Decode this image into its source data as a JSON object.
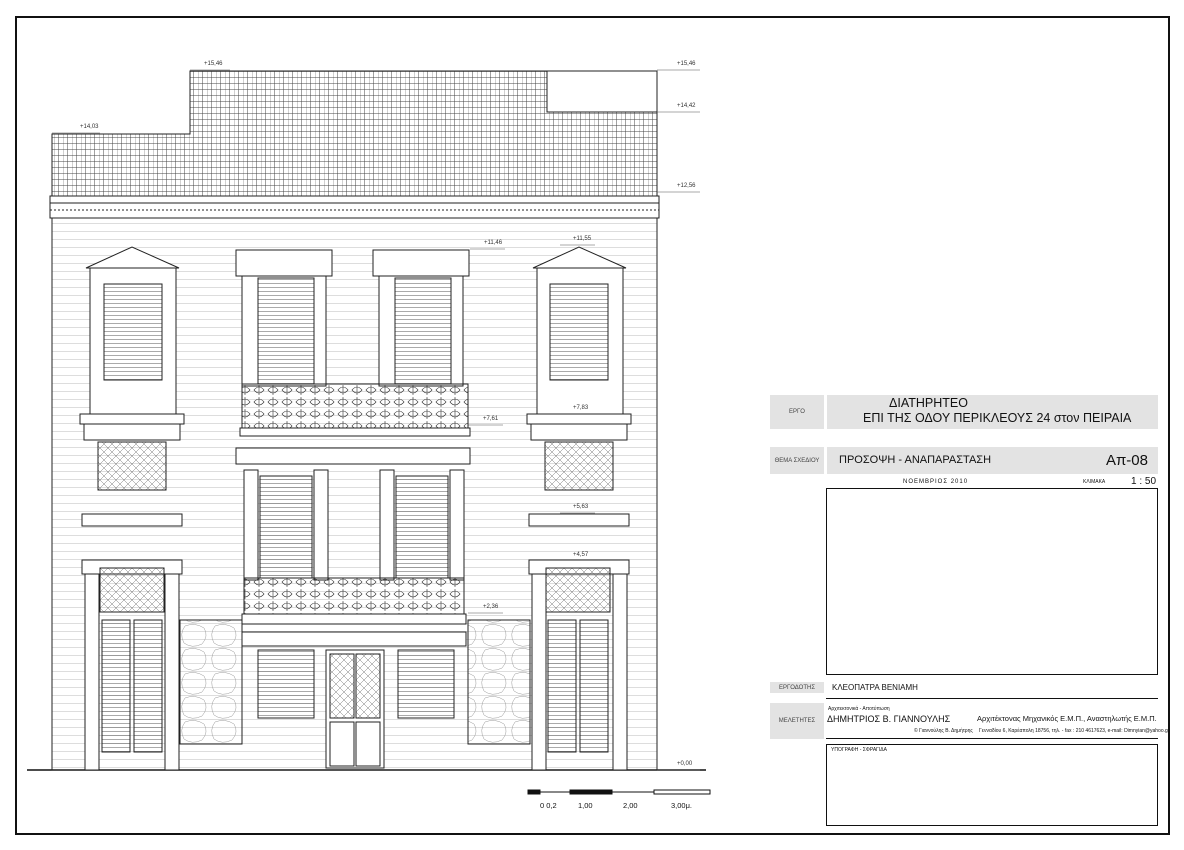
{
  "drawing": {
    "elevations": [
      "+15,46",
      "+15,46",
      "+14,42",
      "+14,03",
      "+12,56",
      "+11,46",
      "+11,55",
      "+7,61",
      "+7,83",
      "+5,63",
      "+4,57",
      "+2,36",
      "+0,00"
    ],
    "scale_bar": [
      "0 0,2",
      "1,00",
      "2,00",
      "3,00μ."
    ]
  },
  "titleblock": {
    "project_label": "ΕΡΓΟ",
    "project_line1": "ΔΙΑΤΗΡΗΤΕΟ",
    "project_line2": "ΕΠΙ ΤΗΣ ΟΔΟΥ ΠΕΡΙΚΛΕΟΥΣ 24 στον ΠΕΙΡΑΙΑ",
    "subject_label": "ΘΕΜΑ ΣΧΕΔΙΟΥ",
    "subject": "ΠΡΟΣΟΨΗ - ΑΝΑΠΑΡΑΣΤΑΣΗ",
    "code": "Απ-08",
    "date": "ΝΟΕΜΒΡΙΟΣ 2010",
    "scale_label": "ΚΛΙΜΑΚΑ",
    "scale": "1 : 50",
    "owner_label": "ΕΡΓΟΔΟΤΗΣ",
    "owner": "ΚΛΕΟΠΑΤΡΑ ΒΕΝΙΑΜΗ",
    "team_label": "ΜΕΛΕΤΗΤΕΣ",
    "team_desc": "Αρχιτεκτονικά - Αποτύπωση",
    "designer": "ΔΗΜΗΤΡΙΟΣ Β. ΓΙΑΝΝΟΥΛΗΣ",
    "designer_role": "Αρχιτέκτονας Μηχανικός Ε.Μ.Π., Αναστηλωτής Ε.Μ.Π.",
    "copyright": "© Γιαννούλης Β. Δημήτρης",
    "address": "Γενναδίου 6, Καρέαπολη 18756, τηλ. - fax : 210 4617623, e-mail: Dimnyian@yahoo.gr",
    "signature_label": "ΥΠΟΓΡΑΦΗ - ΣΦΡΑΓΙΔΑ"
  }
}
